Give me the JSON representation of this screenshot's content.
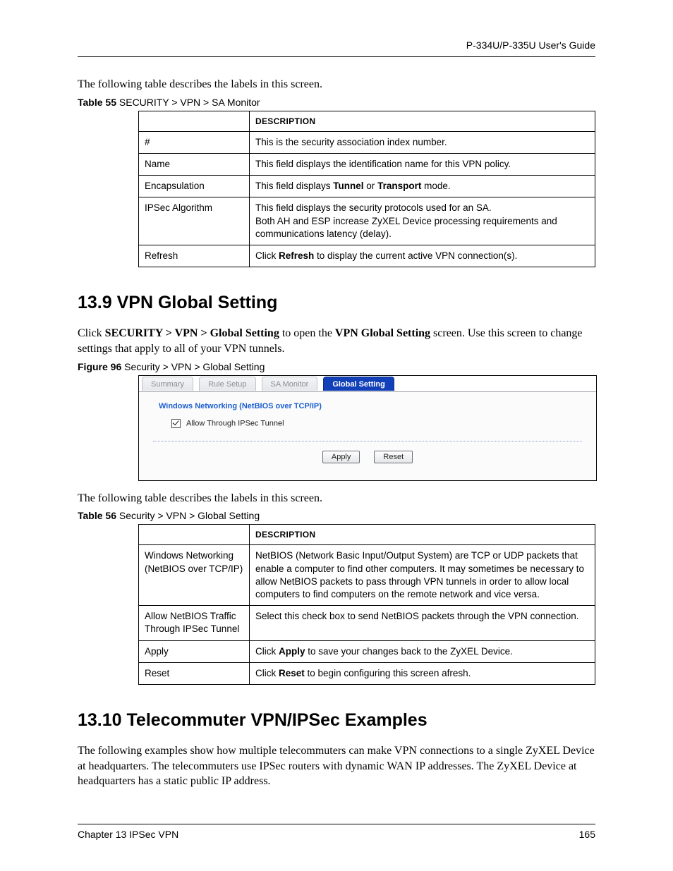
{
  "header": {
    "guide": "P-334U/P-335U User's Guide"
  },
  "intro55": "The following table describes the labels in this screen.",
  "table55": {
    "caption_bold": "Table 55",
    "caption_rest": "   SECURITY > VPN > SA Monitor",
    "colhdr": "DESCRIPTION",
    "rows": [
      {
        "label": "#",
        "desc": "This is the security association index number."
      },
      {
        "label": "Name",
        "desc": "This field displays the identification name for this VPN policy."
      },
      {
        "label": "Encapsulation",
        "desc_pre": "This field displays ",
        "b1": "Tunnel",
        "mid": " or ",
        "b2": "Transport",
        "desc_post": " mode."
      },
      {
        "label": "IPSec Algorithm",
        "desc_l1": "This field displays the security protocols used for an SA.",
        "desc_l2": "Both AH and ESP increase ZyXEL Device processing requirements and communications latency (delay)."
      },
      {
        "label": "Refresh",
        "pre": "Click ",
        "b": "Refresh",
        "post": " to display the current active VPN connection(s)."
      }
    ]
  },
  "sec139": {
    "title": "13.9  VPN Global Setting",
    "p_pre": "Click ",
    "p_b1": "SECURITY > VPN > Global Setting",
    "p_mid": " to open the ",
    "p_b2": "VPN Global Setting",
    "p_post": " screen. Use this screen to change settings that apply to all of your VPN tunnels."
  },
  "fig96": {
    "caption_bold": "Figure 96",
    "caption_rest": "   Security > VPN > Global Setting",
    "tabs": [
      "Summary",
      "Rule Setup",
      "SA Monitor",
      "Global Setting"
    ],
    "sectTitle": "Windows Networking (NetBIOS over TCP/IP)",
    "checkbox": "Allow Through IPSec Tunnel",
    "btnApply": "Apply",
    "btnReset": "Reset"
  },
  "intro56": "The following table describes the labels in this screen.",
  "table56": {
    "caption_bold": "Table 56",
    "caption_rest": "   Security > VPN > Global Setting",
    "colhdr": "DESCRIPTION",
    "rows": [
      {
        "label": "Windows Networking (NetBIOS over TCP/IP)",
        "desc": "NetBIOS (Network Basic Input/Output System) are TCP or UDP packets that enable a computer to find other computers. It may sometimes be necessary to allow NetBIOS packets to pass through VPN tunnels in order to allow local computers to find computers on the remote network and vice versa."
      },
      {
        "label": "Allow NetBIOS Traffic Through IPSec Tunnel",
        "desc": "Select this check box to send NetBIOS packets through the VPN connection."
      },
      {
        "label": "Apply",
        "pre": "Click ",
        "b": "Apply",
        "post": " to save your changes back to the ZyXEL Device."
      },
      {
        "label": "Reset",
        "pre": "Click ",
        "b": "Reset",
        "post": " to begin configuring this screen afresh."
      }
    ]
  },
  "sec1310": {
    "title": "13.10  Telecommuter VPN/IPSec Examples",
    "p": "The following examples show how multiple telecommuters can make VPN connections to a single ZyXEL Device at headquarters. The telecommuters use IPSec routers with dynamic WAN IP addresses. The ZyXEL Device at headquarters has a static public IP address."
  },
  "footer": {
    "left": "Chapter 13 IPSec VPN",
    "right": "165"
  }
}
